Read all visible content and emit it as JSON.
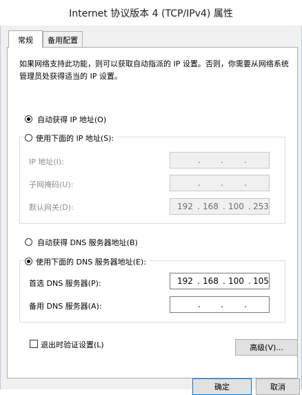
{
  "window": {
    "title": "Internet 协议版本 4 (TCP/IPv4) 属性"
  },
  "tabs": [
    {
      "label": "常规",
      "active": true
    },
    {
      "label": "备用配置",
      "active": false
    }
  ],
  "general": {
    "description": "如果网络支持此功能，则可以获取自动指派的 IP 设置。否则，你需要从网络系统管理员处获得适当的 IP 设置。",
    "ip_mode": {
      "auto_label": "自动获得 IP 地址(O)",
      "manual_label": "使用下面的 IP 地址(S):",
      "selected": "auto"
    },
    "ip_fields": {
      "ip_label": "IP 地址(I):",
      "mask_label": "子网掩码(U):",
      "gateway_label": "默认网关(D):",
      "ip_value": [
        "",
        "",
        "",
        ""
      ],
      "mask_value": [
        "",
        "",
        "",
        ""
      ],
      "gateway_value": [
        "192",
        "168",
        "100",
        "253"
      ]
    },
    "dns_mode": {
      "auto_label": "自动获得 DNS 服务器地址(B)",
      "manual_label": "使用下面的 DNS 服务器地址(E):",
      "selected": "manual"
    },
    "dns_fields": {
      "preferred_label": "首选 DNS 服务器(P):",
      "alternate_label": "备用 DNS 服务器(A):",
      "preferred_value": [
        "192",
        "168",
        "100",
        "105"
      ],
      "alternate_value": [
        "",
        "",
        "",
        ""
      ]
    },
    "validate_label": "退出时验证设置(L)",
    "advanced_label": "高级(V)..."
  },
  "footer": {
    "ok_label": "确定",
    "cancel_label": "取消"
  },
  "colors": {
    "accent": "#0078d7",
    "panel_border": "#adadad"
  }
}
